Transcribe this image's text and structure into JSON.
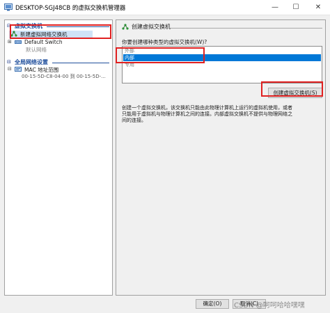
{
  "window": {
    "title": "DESKTOP-SGJ48CB 的虚拟交换机管理器",
    "minimize": "—",
    "maximize": "☐",
    "close": "✕"
  },
  "sidebar": {
    "section1": "虚拟交换机",
    "section1_toggle": "⊟",
    "new_switch": "新建虚拟网络交换机",
    "default_switch": "Default Switch",
    "default_switch_expander": "⊞",
    "default_switch_sub": "默认网络",
    "section2": "全局网络设置",
    "section2_toggle": "⊟",
    "mac_range": "MAC 地址范围",
    "mac_range_expander": "⊟",
    "mac_value": "00-15-5D-C8-04-00 到 00-15-5D-..."
  },
  "main": {
    "header": "创建虚拟交换机",
    "question": "你要创建哪种类型的虚拟交换机(W)?",
    "switch_types": [
      "外部",
      "内部",
      "专用"
    ],
    "selected_index": 1,
    "create_button": "创建虚拟交换机(S)",
    "description": [
      "创建一个虚拟交换机，该交换机只能由此物理计算机上运行的虚拟机使用，或者",
      "只能用于虚拟机与物理计算机之间的连接。内部虚拟交换机不提供与物理网络之",
      "间的连接。"
    ]
  },
  "footer": {
    "ok": "确定(O)",
    "cancel": "取消(C)",
    "watermark": "CSDN @呵呵哈哈嘿嘿"
  },
  "colors": {
    "selection": "#0078d7",
    "section_header": "#1f4e9c",
    "annotation": "#e02020",
    "tree_highlight": "#cfe3f7"
  }
}
